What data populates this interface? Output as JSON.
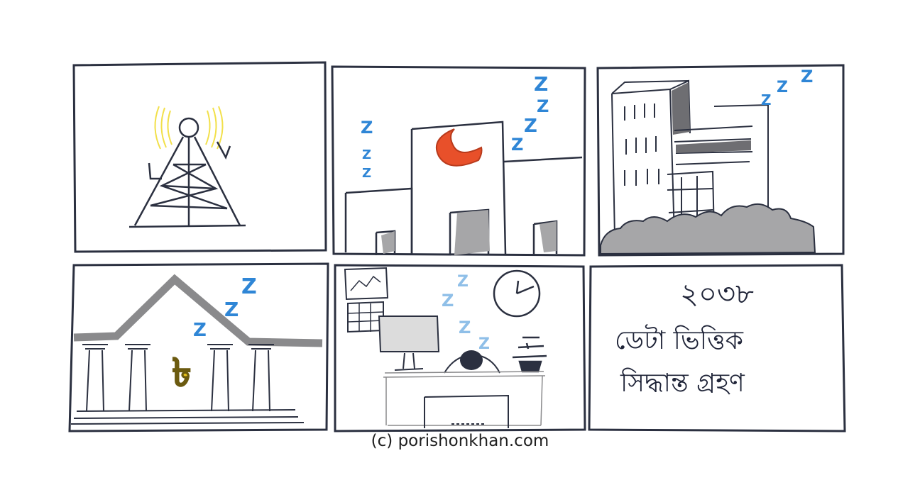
{
  "comic": {
    "panels": [
      {
        "id": "tower",
        "zzz": []
      },
      {
        "id": "office-night",
        "zzz": [
          "Z",
          "Z",
          "Z",
          "Z",
          "Z",
          "Z",
          "Z"
        ]
      },
      {
        "id": "city-buildings",
        "zzz": [
          "Z",
          "Z",
          "Z"
        ]
      },
      {
        "id": "bank",
        "currency_symbol": "৳",
        "zzz": [
          "Z",
          "Z",
          "Z"
        ]
      },
      {
        "id": "office-desk",
        "zzz": [
          "Z",
          "Z",
          "Z",
          "Z"
        ]
      },
      {
        "id": "caption-panel",
        "year": "২০৩৮",
        "line1": "ডেটা ভিত্তিক",
        "line2": "সিদ্ধান্ত গ্রহণ"
      }
    ],
    "credit": "(c) porishonkhan.com"
  },
  "colors": {
    "ink": "#2b3040",
    "zzz_blue": "#2f86d6",
    "moon_red": "#e8502a",
    "signal_yellow": "#f2e04a",
    "taka_gold": "#e8c21c",
    "grey_fill": "#a6a6a8",
    "dark_grey": "#6e6e72"
  }
}
